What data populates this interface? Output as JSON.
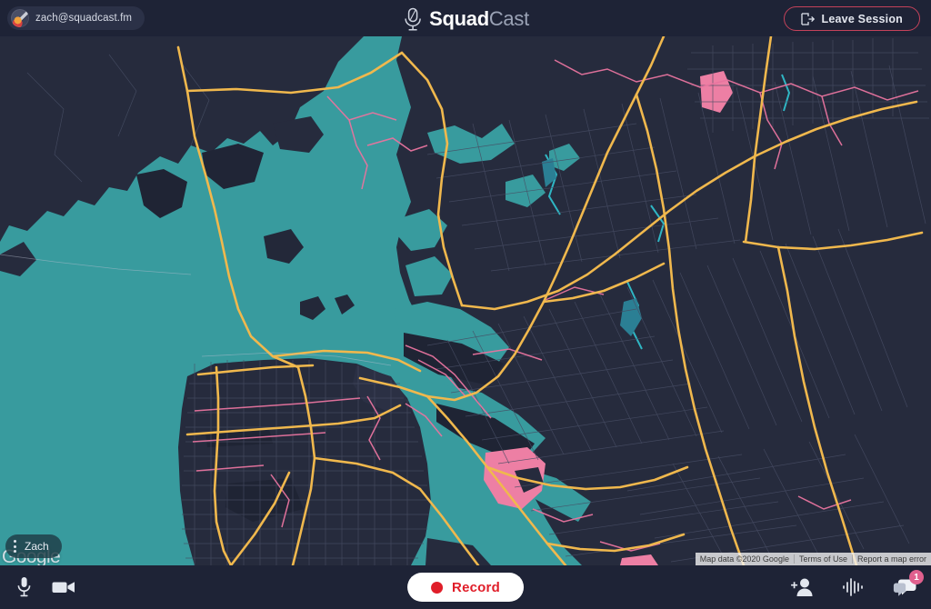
{
  "header": {
    "user_email": "zach@squadcast.fm",
    "avatar_icon": "user-avatar",
    "brand_primary": "Squad",
    "brand_secondary": "Cast",
    "brand_icon": "microphone-logo-icon",
    "leave_label": "Leave Session",
    "leave_icon": "logout-icon",
    "leave_border_color": "#c4425a",
    "bar_color": "#1e2336"
  },
  "map": {
    "participant_label": "Zach",
    "participant_menu_icon": "kebab-menu-icon",
    "provider_watermark": "Google",
    "attribution": {
      "data": "Map data ©2020 Google",
      "terms": "Terms of Use",
      "report": "Report a map error"
    },
    "colors": {
      "water": "#389b9e",
      "land": "#262b3d",
      "land_dark": "#1b2030",
      "highway": "#f0b84d",
      "arterial": "#e8749f",
      "street": "#4a5068",
      "park_pink": "#ed7fa4",
      "stream": "#2fb6c4"
    }
  },
  "footer": {
    "bar_color": "#1e2336",
    "mic_icon": "microphone-icon",
    "camera_icon": "video-camera-icon",
    "record_label": "Record",
    "record_dot_icon": "record-dot-icon",
    "record_color": "#e01e29",
    "invite_icon": "add-person-icon",
    "audio_icon": "audio-waveform-icon",
    "chat_icon": "chat-bubbles-icon",
    "chat_badge_count": "1",
    "chat_badge_color": "#e0608e"
  }
}
